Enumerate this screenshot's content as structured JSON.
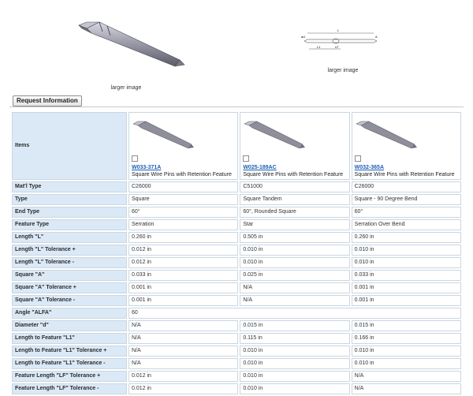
{
  "header": {
    "main_image_caption": "larger image",
    "drawing_image_caption": "larger image",
    "drawing_labels": {
      "L": "L",
      "A": "A",
      "d": "ød",
      "L1": "L1",
      "LF": "LF"
    }
  },
  "request_button": "Request Information",
  "table": {
    "items_label": "Items",
    "products": [
      {
        "part": "W033-371A",
        "desc": "Square Wire Pins with Retention Feature"
      },
      {
        "part": "W025-189AC",
        "desc": "Square Wire Pins with Retention Feature"
      },
      {
        "part": "W032-365A",
        "desc": "Square Wire Pins with Retention Feature"
      }
    ],
    "rows": [
      {
        "label": "Mat'l Type",
        "values": [
          "C26000",
          "C51000",
          "C26000"
        ]
      },
      {
        "label": "Type",
        "values": [
          "Square",
          "Square Tandem",
          "Square - 90 Degree Bend"
        ]
      },
      {
        "label": "End Type",
        "values": [
          "60°",
          "60°, Rounded Square",
          "60°"
        ]
      },
      {
        "label": "Feature Type",
        "values": [
          "Serration",
          "Star",
          "Serration Over Bend"
        ]
      },
      {
        "label": "Length \"L\"",
        "values": [
          "0.260 in",
          "0.505 in",
          "0.260 in"
        ]
      },
      {
        "label": "Length \"L\" Tolerance +",
        "values": [
          "0.012 in",
          "0.010 in",
          "0.010 in"
        ]
      },
      {
        "label": "Length \"L\" Tolerance -",
        "values": [
          "0.012 in",
          "0.010 in",
          "0.010 in"
        ]
      },
      {
        "label": "Square \"A\"",
        "values": [
          "0.033 in",
          "0.025 in",
          "0.033 in"
        ]
      },
      {
        "label": "Square \"A\" Tolerance +",
        "values": [
          "0.001 in",
          "N/A",
          "0.001 in"
        ]
      },
      {
        "label": "Square \"A\" Tolerance -",
        "values": [
          "0.001 in",
          "N/A",
          "0.001 in"
        ]
      },
      {
        "label": "Angle \"ALFA\"",
        "values": [
          "60"
        ]
      },
      {
        "label": "Diameter \"d\"",
        "values": [
          "N/A",
          "0.015 in",
          "0.015 in"
        ]
      },
      {
        "label": "Length to Feature \"L1\"",
        "values": [
          "N/A",
          "0.115 in",
          "0.166 in"
        ]
      },
      {
        "label": "Length to Feature \"L1\" Tolerance +",
        "values": [
          "N/A",
          "0.010 in",
          "0.010 in"
        ]
      },
      {
        "label": "Length to Feature \"L1\" Tolerance -",
        "values": [
          "N/A",
          "0.010 in",
          "0.010 in"
        ]
      },
      {
        "label": "Feature Length \"LF\" Tolerance +",
        "values": [
          "0.012 in",
          "0.010 in",
          "N/A"
        ]
      },
      {
        "label": "Feature Length \"LF\" Tolerance -",
        "values": [
          "0.012 in",
          "0.010 in",
          "N/A"
        ]
      }
    ]
  }
}
